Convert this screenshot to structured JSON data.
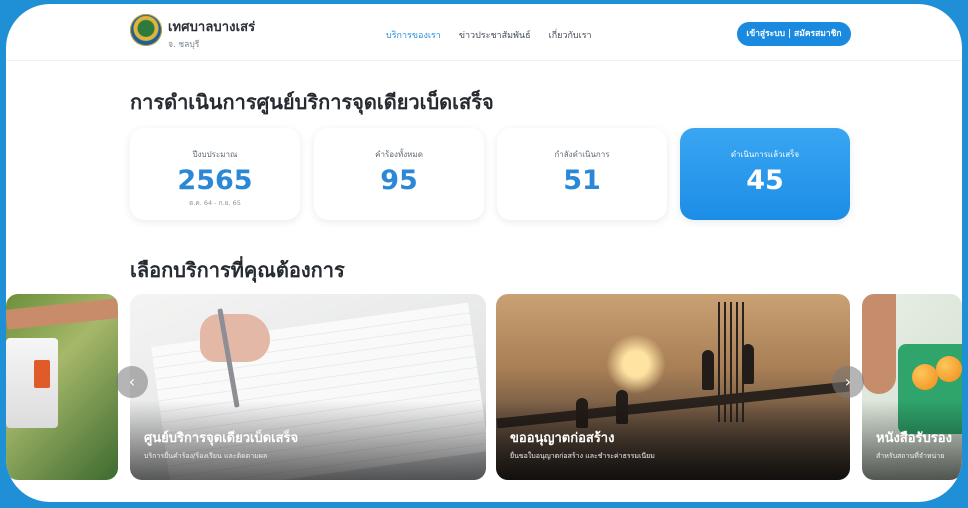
{
  "header": {
    "brand_name": "เทศบาลบางเสร่",
    "brand_sub": "จ. ชลบุรี",
    "nav": [
      "บริการของเรา",
      "ข่าวประชาสัมพันธ์",
      "เกี่ยวกับเรา"
    ],
    "login_label": "เข้าสู่ระบบ | สมัครสมาชิก"
  },
  "main": {
    "title": "การดำเนินการศูนย์บริการจุดเดียวเบ็ดเสร็จ",
    "stats": [
      {
        "label": "ปีงบประมาณ",
        "value": "2565",
        "sub": "ต.ค. 64 - ก.ย. 65"
      },
      {
        "label": "คำร้องทั้งหมด",
        "value": "95"
      },
      {
        "label": "กำลังดำเนินการ",
        "value": "51"
      },
      {
        "label": "ดำเนินการแล้วเสร็จ",
        "value": "45"
      }
    ],
    "services_title": "เลือกบริการที่คุณต้องการ",
    "services": [
      {
        "title": "ศูนย์บริการจุดเดียวเบ็ดเสร็จ",
        "desc": "บริการยื่นคำร้อง/ร้องเรียน และติดตามผล"
      },
      {
        "title": "ขออนุญาตก่อสร้าง",
        "desc": "ยื่นขอใบอนุญาตก่อสร้าง และชำระค่าธรรมเนียม"
      },
      {
        "title": "หนังสือรับรอง",
        "desc": "สำหรับสถานที่จำหน่าย"
      }
    ]
  },
  "colors": {
    "accent": "#1a8ae0",
    "page_bg": "#1f8fd6",
    "highlight_card": "#2a9ae8"
  },
  "icons": {
    "prev": "chevron-left-icon",
    "next": "chevron-right-icon"
  }
}
